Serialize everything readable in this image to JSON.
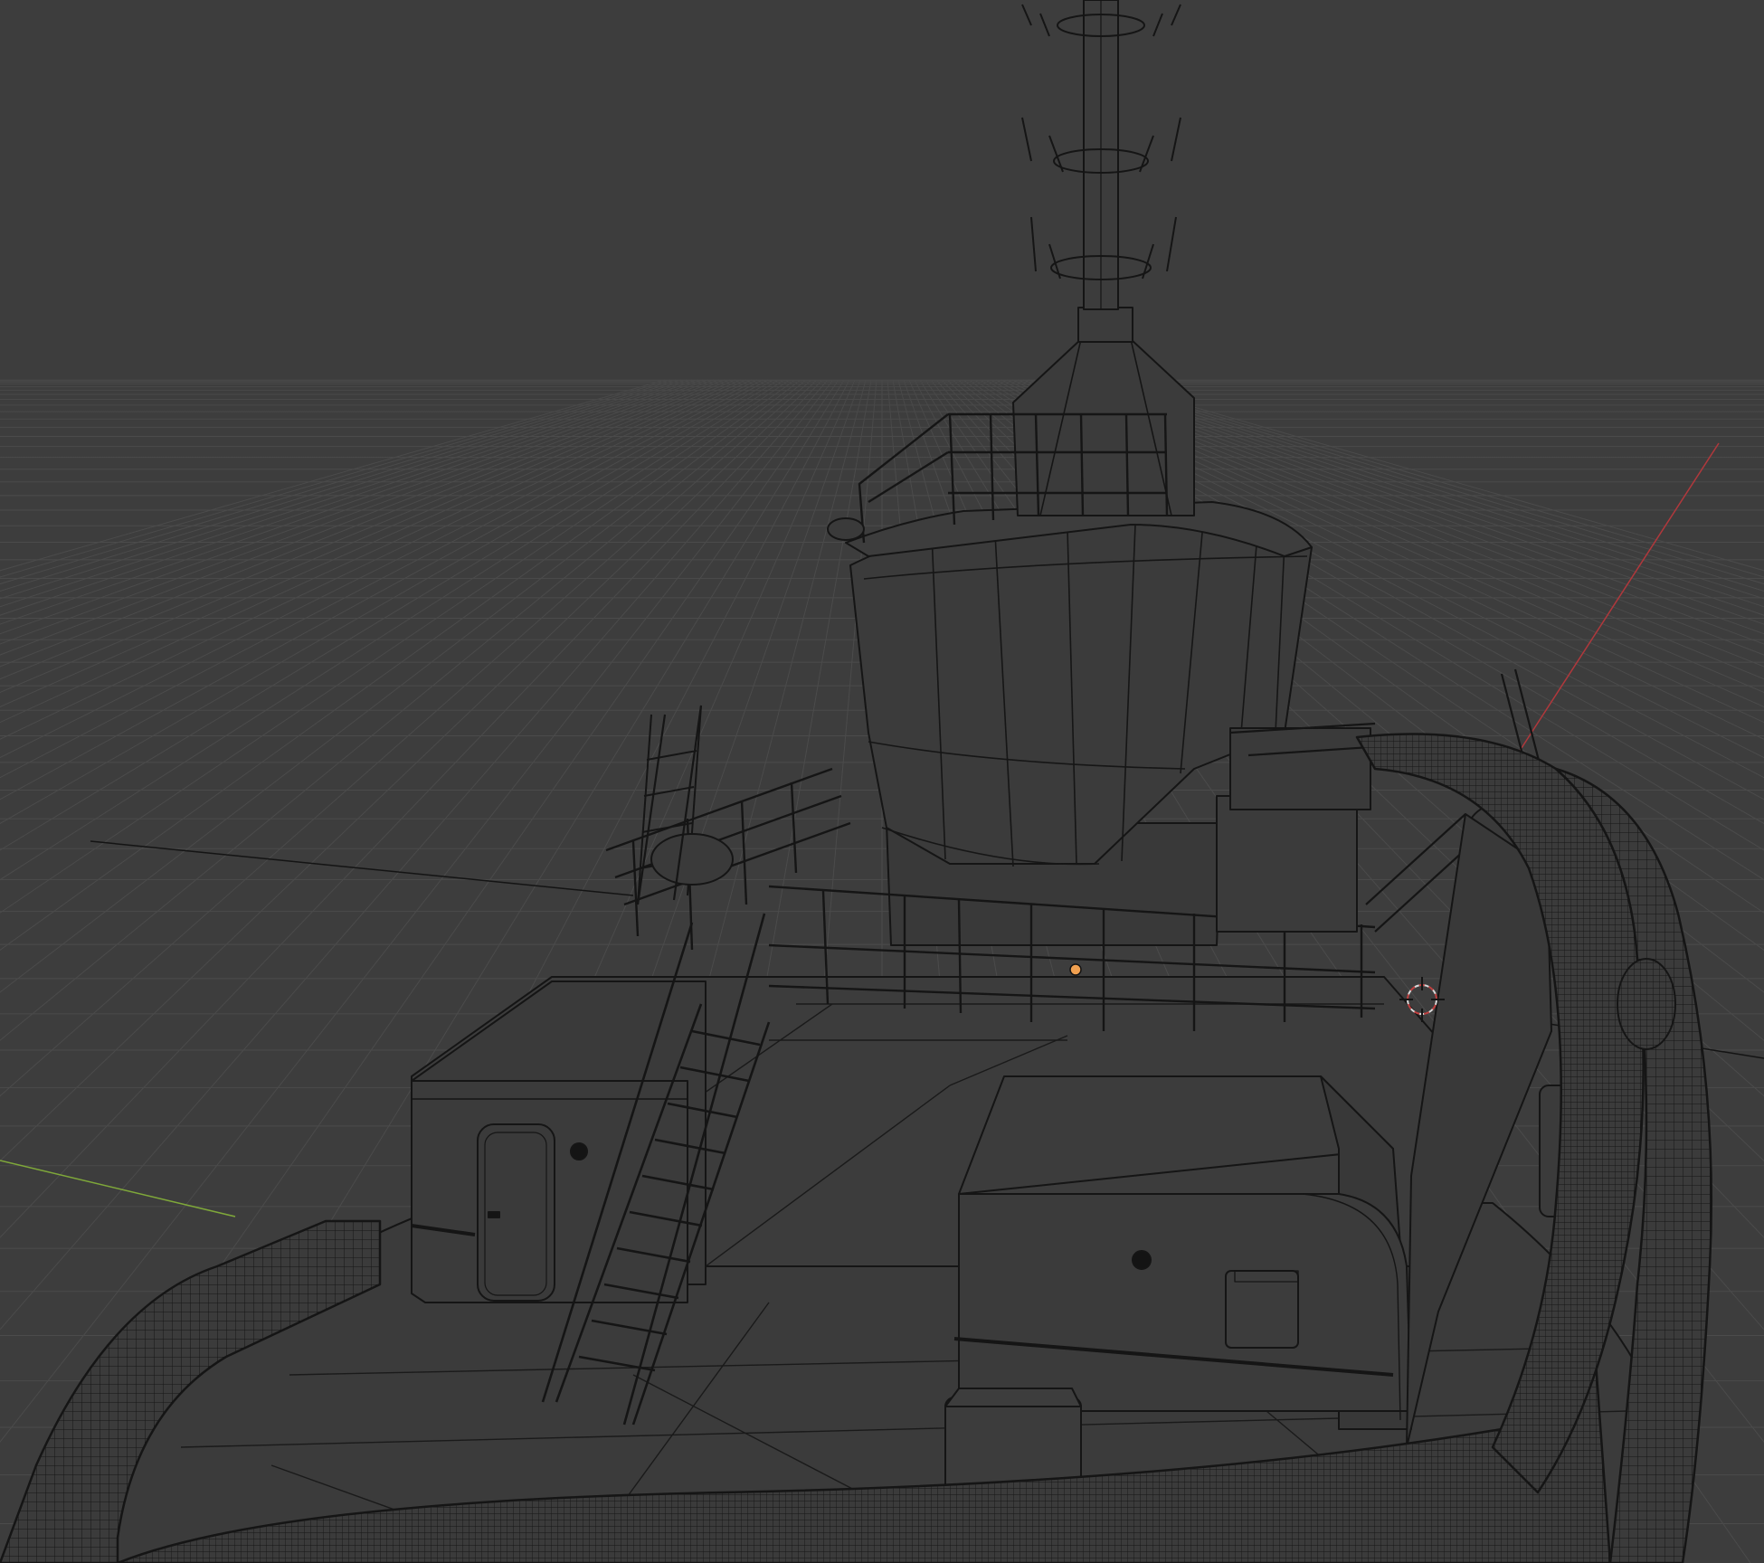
{
  "viewport": {
    "mode": "wireframe",
    "background": "#3d3d3d",
    "grid_color": "#4a4a4a",
    "wire_color": "#141414",
    "fill_color": "#3a3a3a",
    "x_axis_color": "#b0383c",
    "y_axis_color": "#7fa83a",
    "origin_dot_color": "#f0a050",
    "cursor_color": "#d9d9d9",
    "cursor_accent": "#c04040"
  },
  "scene": {
    "object": "tugboat",
    "parts": [
      "mast",
      "antenna-rings",
      "bridge-railing",
      "wheelhouse",
      "upper-deck",
      "stair-ladder",
      "deck-house",
      "door",
      "bollard",
      "fender",
      "winch-box"
    ]
  }
}
